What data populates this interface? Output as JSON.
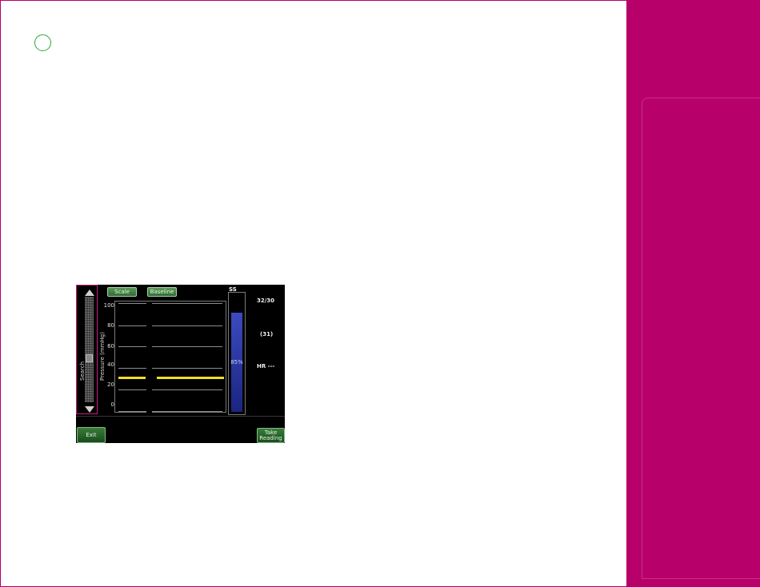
{
  "monitor": {
    "scale_button": "Scale",
    "baseline_button": "Baseline",
    "search_label": "Search",
    "pressure_axis_label": "Pressure (mmHg)",
    "y_ticks": [
      "100",
      "80",
      "60",
      "40",
      "20",
      "0"
    ],
    "ss_label": "SS",
    "ss_percent_text": "85%",
    "ss_percent_value": 0.85,
    "systolic_diastolic": "32/30",
    "mean_pressure": "(31)",
    "heart_rate": "HR ---",
    "exit_button": "Exit",
    "take_reading_line1": "Take",
    "take_reading_line2": "Reading"
  },
  "colors": {
    "brand_magenta": "#b8006b",
    "step_circle": "#2aa63b",
    "trace_yellow": "#f0e020",
    "ss_blue": "#3c4ac0",
    "button_green": "#2e6b32"
  }
}
